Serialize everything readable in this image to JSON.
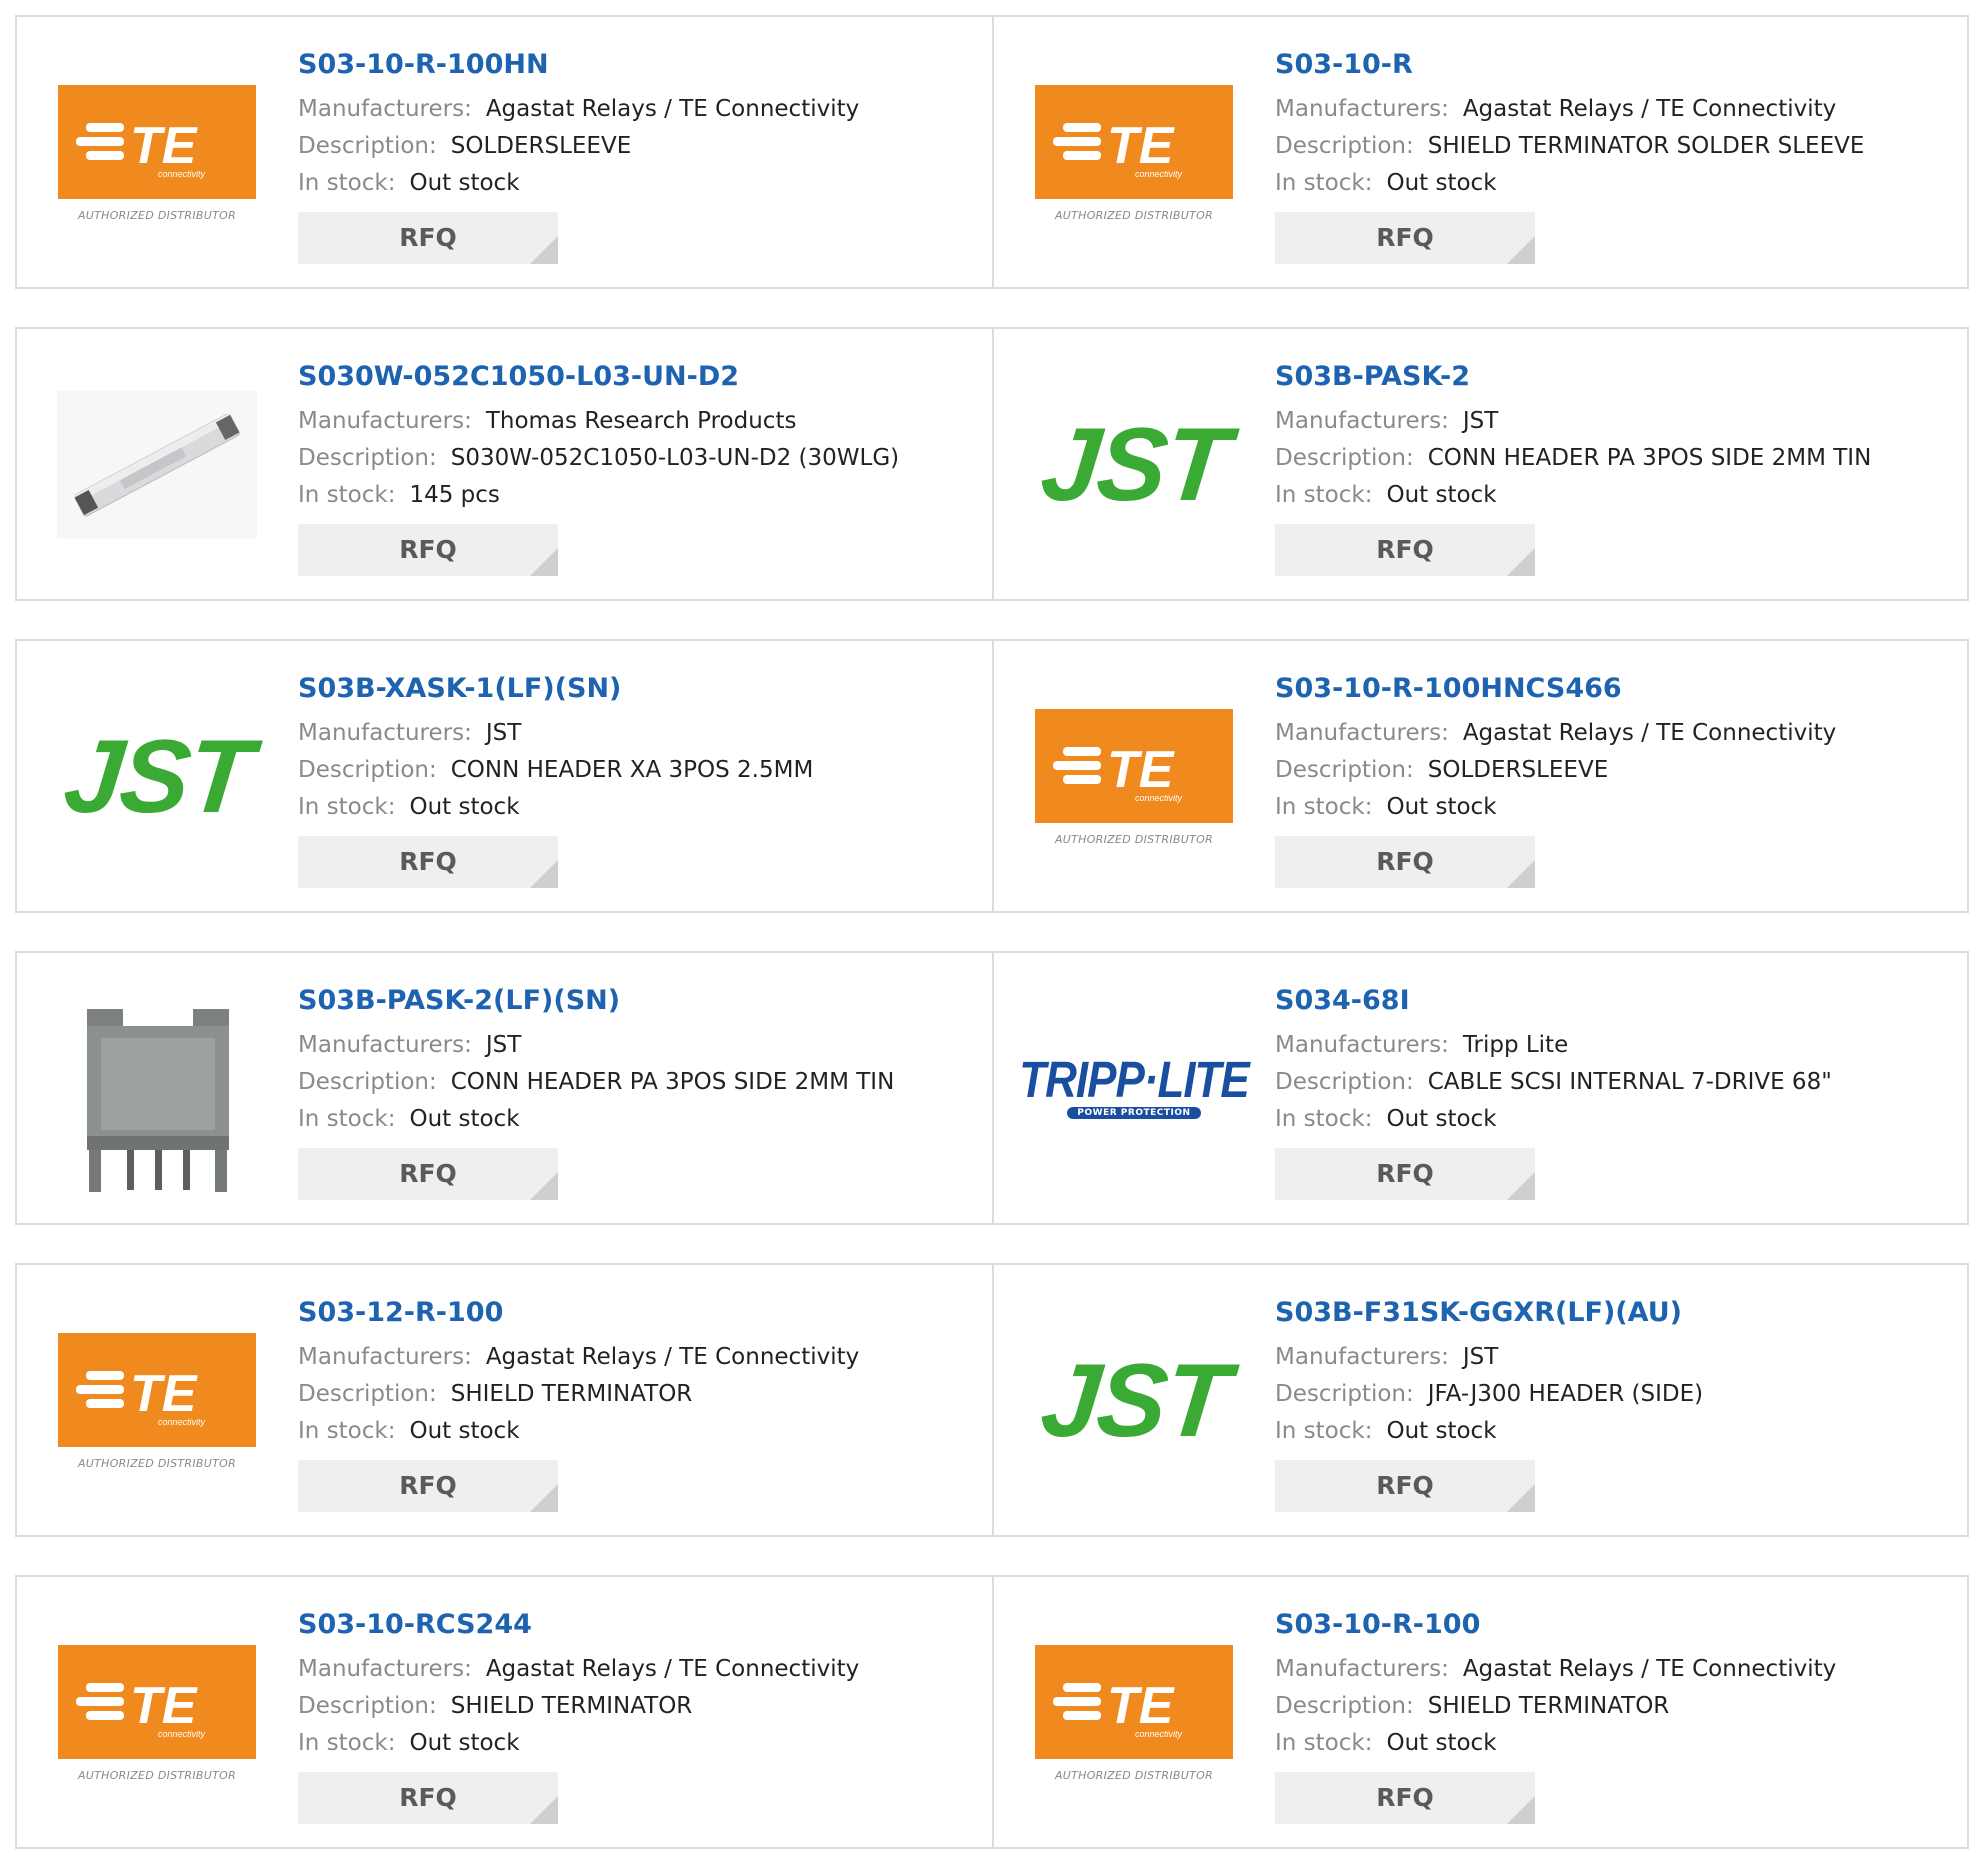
{
  "labels": {
    "manufacturers": "Manufacturers:",
    "description": "Description:",
    "in_stock": "In stock:",
    "rfq": "RFQ"
  },
  "brands": {
    "te": {
      "text": "TE",
      "sub": "connectivity",
      "tagline": "AUTHORIZED DISTRIBUTOR",
      "color": "#f08a1e"
    },
    "jst": {
      "text": "JST",
      "color": "#3aaa35"
    },
    "tripp": {
      "text": "TRIPP·LITE",
      "sub": "POWER PROTECTION",
      "color": "#1a4fa0"
    }
  },
  "colors": {
    "title": "#1d63b0",
    "label": "#8a8a8a",
    "border": "#dcdcdc",
    "button": "#efefef"
  },
  "products": [
    {
      "part": "S03-10-R-100HN",
      "manufacturer": "Agastat Relays / TE Connectivity",
      "description": "SOLDERSLEEVE",
      "stock": "Out stock",
      "logo": "te"
    },
    {
      "part": "S03-10-R",
      "manufacturer": "Agastat Relays / TE Connectivity",
      "description": "SHIELD TERMINATOR SOLDER SLEEVE",
      "stock": "Out stock",
      "logo": "te"
    },
    {
      "part": "S030W-052C1050-L03-UN-D2",
      "manufacturer": "Thomas Research Products",
      "description": "S030W-052C1050-L03-UN-D2 (30WLG)",
      "stock": "145 pcs",
      "logo": "driver-photo"
    },
    {
      "part": "S03B-PASK-2",
      "manufacturer": "JST",
      "description": "CONN HEADER PA 3POS SIDE 2MM TIN",
      "stock": "Out stock",
      "logo": "jst"
    },
    {
      "part": "S03B-XASK-1(LF)(SN)",
      "manufacturer": "JST",
      "description": "CONN HEADER XA 3POS 2.5MM",
      "stock": "Out stock",
      "logo": "jst"
    },
    {
      "part": "S03-10-R-100HNCS466",
      "manufacturer": "Agastat Relays / TE Connectivity",
      "description": "SOLDERSLEEVE",
      "stock": "Out stock",
      "logo": "te"
    },
    {
      "part": "S03B-PASK-2(LF)(SN)",
      "manufacturer": "JST",
      "description": "CONN HEADER PA 3POS SIDE 2MM TIN",
      "stock": "Out stock",
      "logo": "connector-photo"
    },
    {
      "part": "S034-68I",
      "manufacturer": "Tripp Lite",
      "description": "CABLE SCSI INTERNAL 7-DRIVE 68\"",
      "stock": "Out stock",
      "logo": "tripp"
    },
    {
      "part": "S03-12-R-100",
      "manufacturer": "Agastat Relays / TE Connectivity",
      "description": "SHIELD TERMINATOR",
      "stock": "Out stock",
      "logo": "te"
    },
    {
      "part": "S03B-F31SK-GGXR(LF)(AU)",
      "manufacturer": "JST",
      "description": "JFA-J300 HEADER (SIDE)",
      "stock": "Out stock",
      "logo": "jst"
    },
    {
      "part": "S03-10-RCS244",
      "manufacturer": "Agastat Relays / TE Connectivity",
      "description": "SHIELD TERMINATOR",
      "stock": "Out stock",
      "logo": "te"
    },
    {
      "part": "S03-10-R-100",
      "manufacturer": "Agastat Relays / TE Connectivity",
      "description": "SHIELD TERMINATOR",
      "stock": "Out stock",
      "logo": "te"
    }
  ]
}
